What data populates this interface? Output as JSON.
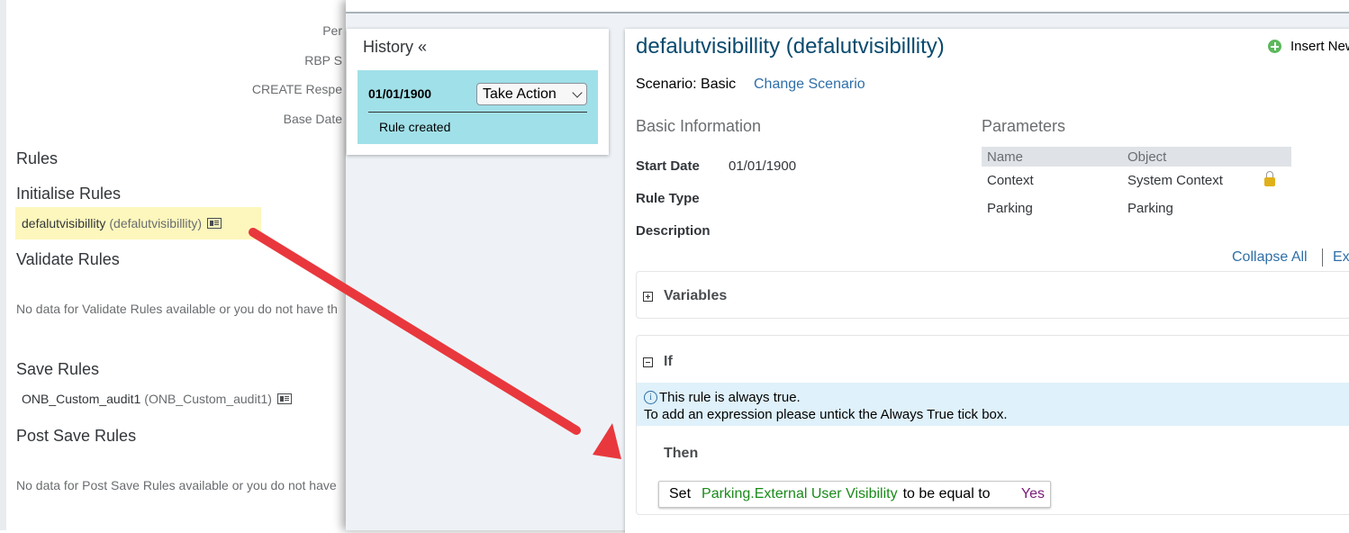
{
  "left_panel": {
    "fields": [
      "Per",
      "RBP S",
      "CREATE Respe",
      "Base Date"
    ],
    "sections": {
      "rules": "Rules",
      "initialise": "Initialise Rules",
      "validate": "Validate Rules",
      "save": "Save Rules",
      "post_save": "Post Save Rules"
    },
    "initialise_rule": {
      "name": "defalutvisibillity",
      "id": "(defalutvisibillity)"
    },
    "validate_nodata": "No data for Validate Rules available or you do not have th",
    "save_rule": {
      "name": "ONB_Custom_audit1",
      "id": "(ONB_Custom_audit1)"
    },
    "post_save_nodata": "No data for Post Save Rules available or you do not have"
  },
  "history": {
    "title": "History",
    "collapse": "«",
    "entry": {
      "date": "01/01/1900",
      "action": "Take Action",
      "note": "Rule created"
    }
  },
  "rule": {
    "title": "defalutvisibillity (defalutvisibillity)",
    "insert_new": "Insert New",
    "scenario": "Scenario: Basic",
    "change_scenario": "Change Scenario",
    "basic_info": {
      "title": "Basic Information",
      "start_date_label": "Start Date",
      "start_date": "01/01/1900",
      "rule_type_label": "Rule Type",
      "description_label": "Description"
    },
    "parameters": {
      "title": "Parameters",
      "headers": [
        "Name",
        "Object"
      ],
      "rows": [
        {
          "name": "Context",
          "object": "System Context",
          "locked": true
        },
        {
          "name": "Parking",
          "object": "Parking",
          "locked": false
        }
      ]
    },
    "collapse_all": "Collapse All",
    "expand_all": "Ex",
    "variables": "Variables",
    "if_title": "If",
    "info_line1": "This rule is always true.",
    "info_line2": "To add an expression please untick the Always True tick box.",
    "then": "Then",
    "set": {
      "keyword": "Set",
      "field": "Parking.External User Visibility",
      "operator": "to be equal to",
      "value": "Yes"
    }
  },
  "colors": {
    "accent_link": "#2f6fa7",
    "title_blue": "#0a4a6e",
    "history_entry": "#a0e0e8",
    "highlight": "#fdf7bd",
    "arrow": "#e8383d",
    "field_green": "#1a8a1a",
    "value_purple": "#7a1a7a"
  }
}
